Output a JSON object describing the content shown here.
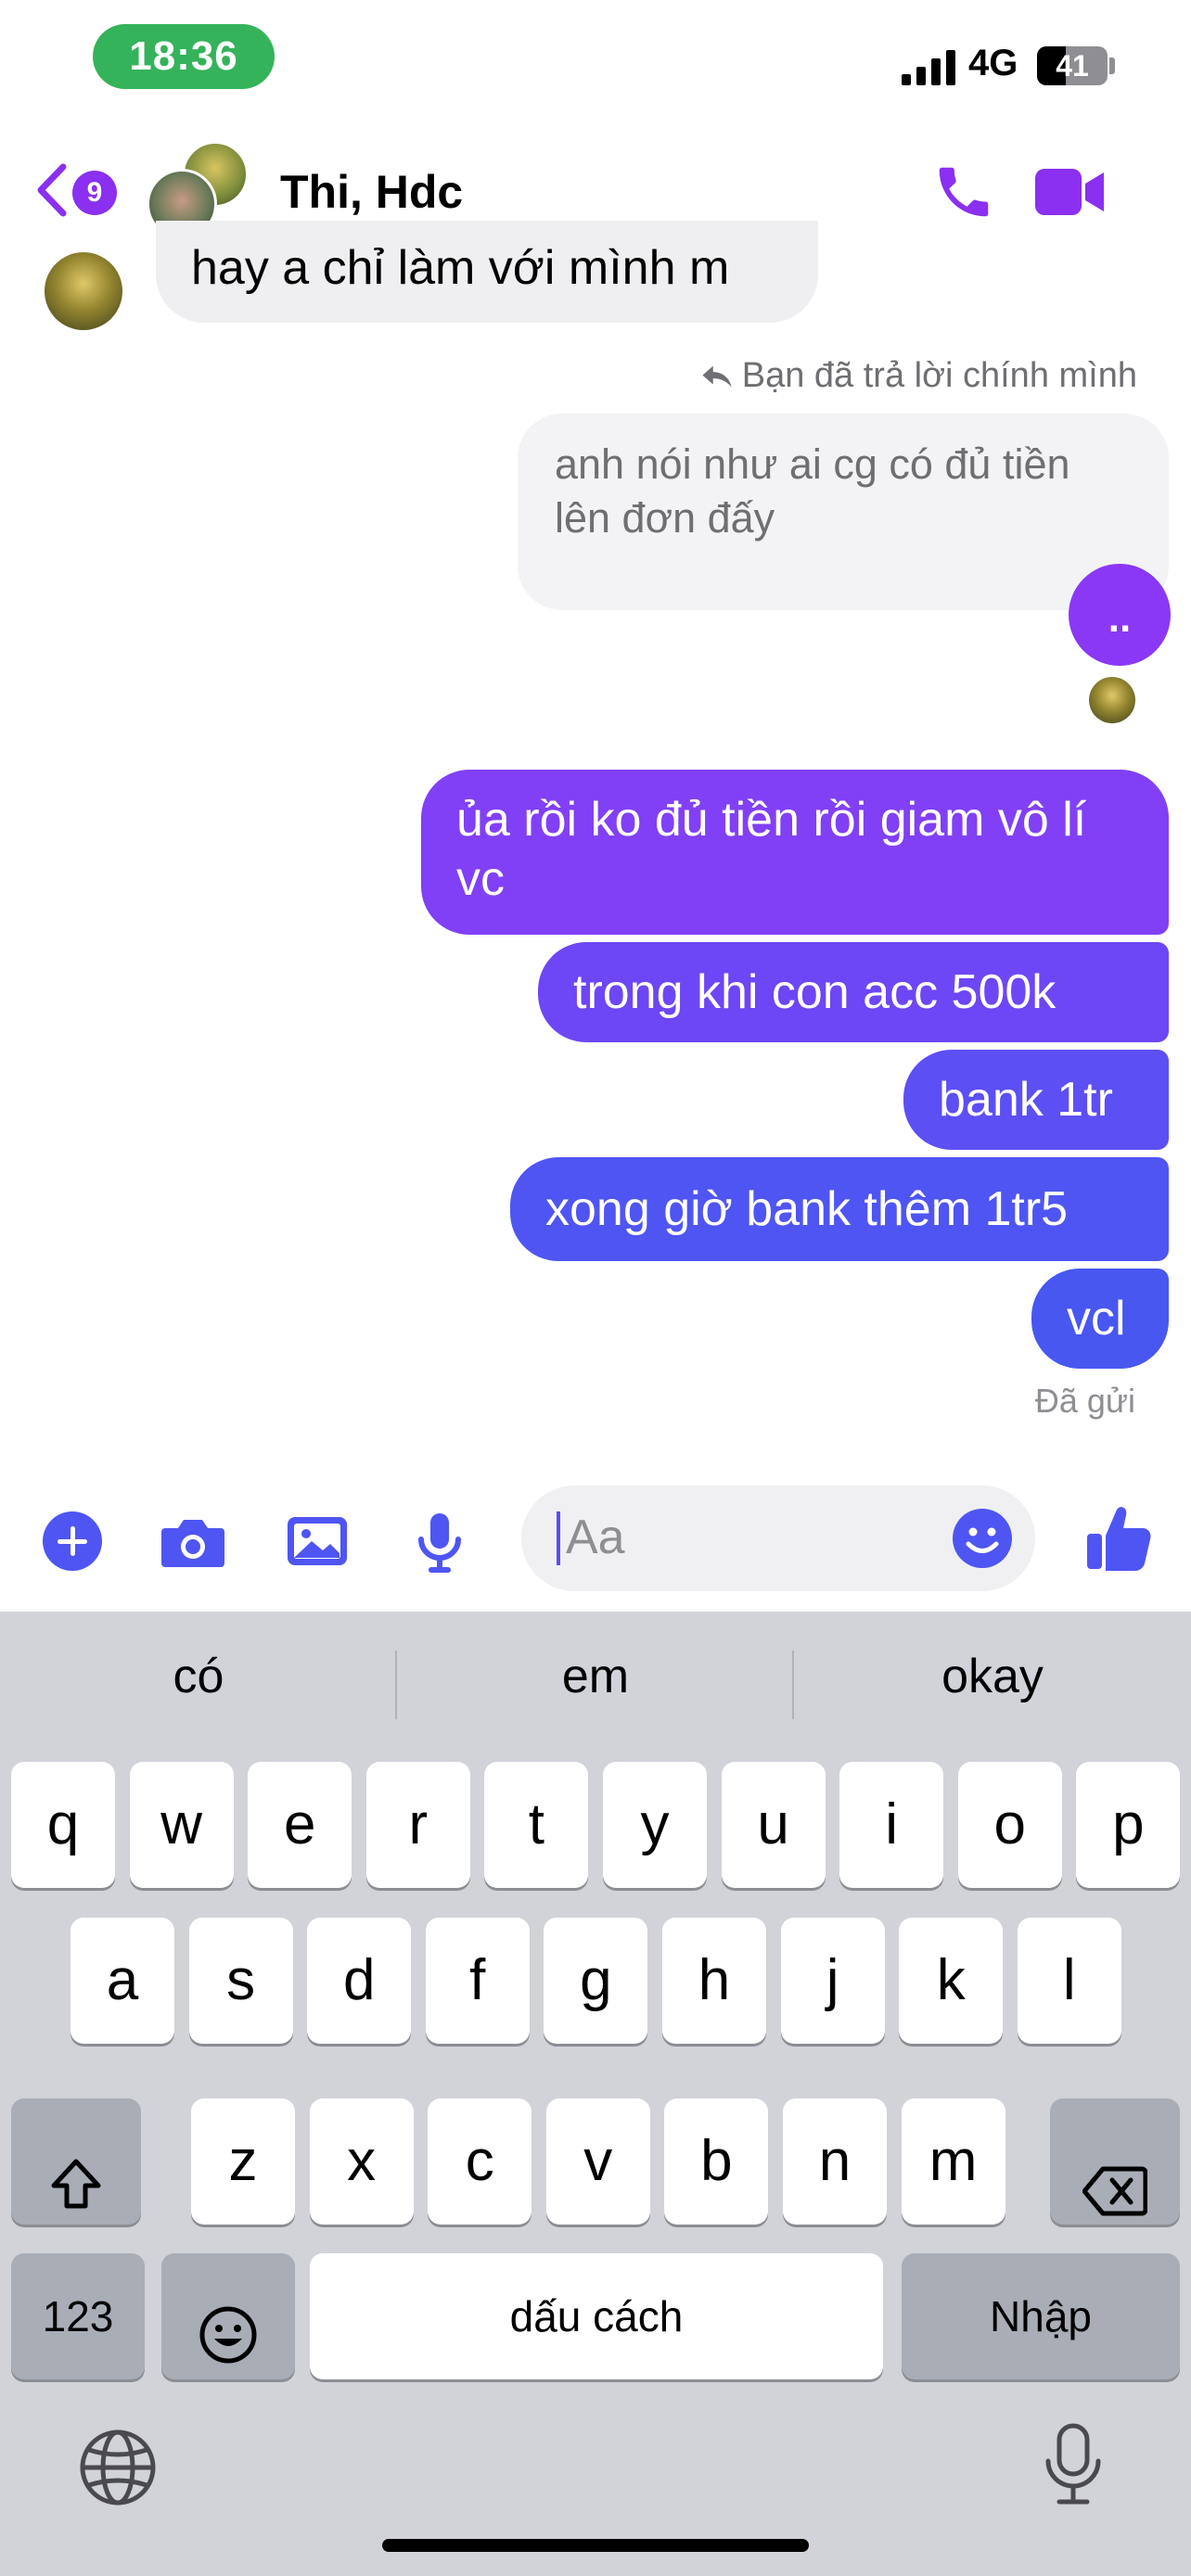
{
  "status_bar": {
    "time": "18:36",
    "network": "4G",
    "battery": "41",
    "battery_level": 0.41
  },
  "header": {
    "back_badge": "9",
    "title": "Thi, Hdc",
    "accent_color": "#8b2ff0"
  },
  "messages": {
    "incoming_partial": "hay a chỉ làm với mình m",
    "reply_note": "Bạn đã trả lời chính mình",
    "quoted_text": "anh nói như ai cg có đủ tiền lên đơn đấy",
    "mini_bubble": "..",
    "outgoing": [
      "ủa rồi ko đủ tiền rồi giam vô lí vc",
      "trong khi con acc 500k",
      "bank 1tr",
      "xong giờ bank thêm 1tr5",
      "vcl"
    ],
    "sent_status": "Đã gửi"
  },
  "composer": {
    "placeholder": "Aa",
    "icons": [
      "plus-icon",
      "camera-icon",
      "image-icon",
      "microphone-icon",
      "emoji-icon",
      "thumbs-up-icon"
    ]
  },
  "keyboard": {
    "suggestions": [
      "có",
      "em",
      "okay"
    ],
    "row1": [
      "q",
      "w",
      "e",
      "r",
      "t",
      "y",
      "u",
      "i",
      "o",
      "p"
    ],
    "row2": [
      "a",
      "s",
      "d",
      "f",
      "g",
      "h",
      "j",
      "k",
      "l"
    ],
    "row3": [
      "z",
      "x",
      "c",
      "v",
      "b",
      "n",
      "m"
    ],
    "numbers_key": "123",
    "space_key": "dấu cách",
    "return_key": "Nhập"
  }
}
